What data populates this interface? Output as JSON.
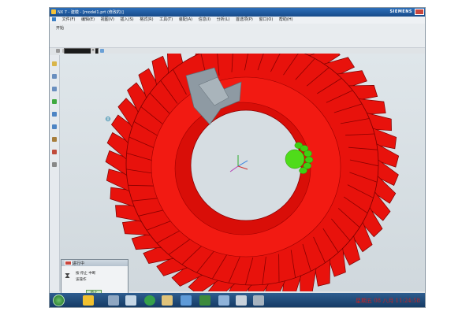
{
  "window": {
    "title": "NX 7 - 建模 - [model1.prt (修改的)]",
    "brand": "SIEMENS"
  },
  "menu": {
    "items": [
      "文件(F)",
      "编辑(E)",
      "视图(V)",
      "插入(S)",
      "格式(R)",
      "工具(T)",
      "装配(A)",
      "信息(I)",
      "分析(L)",
      "首选项(P)",
      "窗口(O)",
      "帮助(H)"
    ]
  },
  "toolbar": {
    "start_label": "开始"
  },
  "dialog": {
    "title": "任务进行中",
    "line1": "按 停止 中断",
    "line2": "该操作",
    "button": "停止"
  },
  "taskbar": {
    "clock": "星期五 08 八月 11:24:58"
  },
  "colors": {
    "gear_red": "#e8120c",
    "pinion_green": "#3fcf12",
    "title_blue": "#1e5aa0",
    "clock_red": "#c92222"
  },
  "icons": [
    "nx-logo-icon",
    "hourglass-icon",
    "windows-orb-icon",
    "explorer-icon",
    "folder-icon",
    "nx-app-icon"
  ]
}
